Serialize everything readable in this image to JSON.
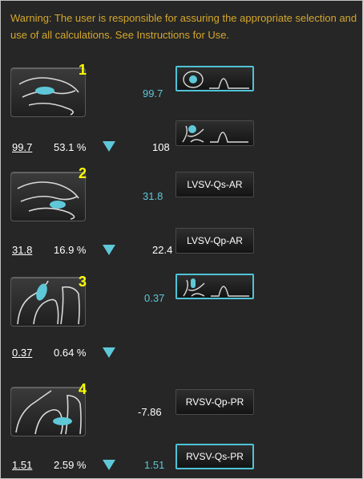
{
  "warning": "Warning: The user is responsible for assuring the appropriate selection and use of all calculations. See Instructions for Use.",
  "colors": {
    "accent": "#5ec8d8",
    "warning": "#d4a72c",
    "marker": "#ffff00",
    "background": "#262626"
  },
  "rows": [
    {
      "marker": "1",
      "value": "99.7",
      "percent": "53.1 %"
    },
    {
      "marker": "2",
      "value": "31.8",
      "percent": "16.9 %"
    },
    {
      "marker": "3",
      "value": "0.37",
      "percent": "0.64 %"
    },
    {
      "marker": "4",
      "value": "1.51",
      "percent": "2.59 %"
    }
  ],
  "results": {
    "r1": "99.7",
    "r2": "108",
    "r3": "31.8",
    "r4": "22.4",
    "r5": "0.37",
    "r6": "-7.86",
    "r7": "1.51"
  },
  "buttons": {
    "b1": "",
    "b2": "",
    "b3": "LVSV-Qs-AR",
    "b4": "LVSV-Qp-AR",
    "b5": "",
    "b6": "RVSV-Qp-PR",
    "b7": "RVSV-Qs-PR"
  },
  "icons": {
    "thumb1": "lv-outflow-view-icon",
    "thumb2": "lv-outflow-view-icon",
    "thumb3": "rv-outflow-view-icon",
    "thumb4": "rv-outflow-view-icon",
    "flow": "flow-curve-icon"
  }
}
